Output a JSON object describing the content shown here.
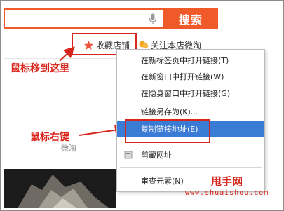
{
  "search": {
    "value": "",
    "button_label": "搜索"
  },
  "store_row": {
    "favorite_label": "收藏店铺",
    "follow_label": "关注本店微淘"
  },
  "annotations": {
    "move_here": "鼠标移到这里",
    "right_click": "鼠标右键"
  },
  "weitao_label": "微淘",
  "context_menu": {
    "items": [
      {
        "label": "在新标签页中打开链接(T)"
      },
      {
        "label": "在新窗口中打开链接(W)"
      },
      {
        "label": "在隐身窗口中打开链接(G)"
      },
      {
        "label": "链接另存为(K)..."
      },
      {
        "label": "复制链接地址(E)"
      },
      {
        "label": "剪藏网址"
      },
      {
        "label": "审查元素(N)"
      }
    ]
  },
  "watermark": {
    "title": "甩手网",
    "url": "www.shuaishou.com"
  },
  "colors": {
    "accent": "#f05a2a",
    "annotation": "#d9261c",
    "selection": "#3a7bd5"
  },
  "icons": {
    "mic": "microphone-icon",
    "star": "star-icon",
    "wechat": "wechat-icon",
    "bookmark": "bookmark-icon"
  }
}
